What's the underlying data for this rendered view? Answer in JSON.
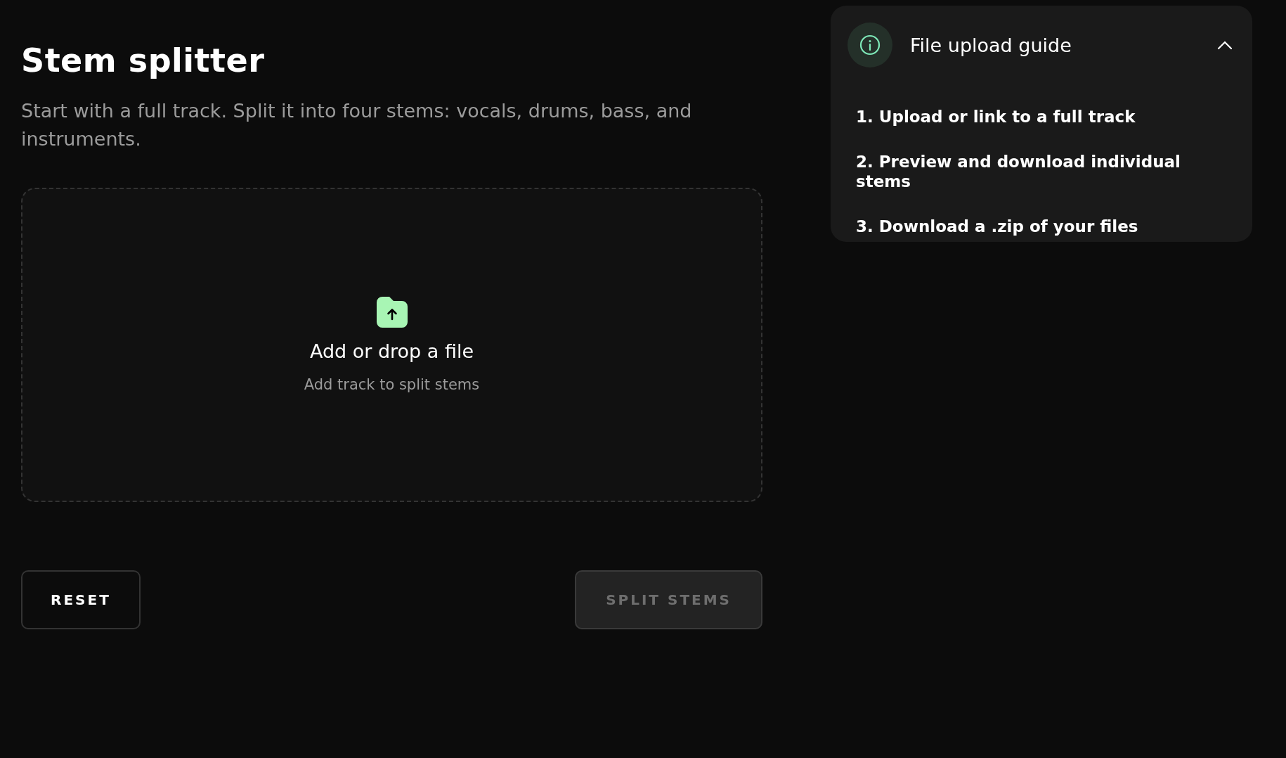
{
  "header": {
    "title": "Stem splitter",
    "description": "Start with a full track. Split it into four stems: vocals, drums, bass, and instruments."
  },
  "dropzone": {
    "label": "Add or drop a file",
    "hint": "Add track to split stems"
  },
  "buttons": [
    {
      "label": "RESET",
      "kind": "secondary",
      "disabled": false
    },
    {
      "label": "SPLIT STEMS",
      "kind": "primary",
      "disabled": true
    }
  ],
  "guide": {
    "title": "File upload guide",
    "expanded": true,
    "steps": [
      "1. Upload or link to a full track",
      "2. Preview and download individual stems",
      "3. Download a .zip of your files"
    ]
  }
}
